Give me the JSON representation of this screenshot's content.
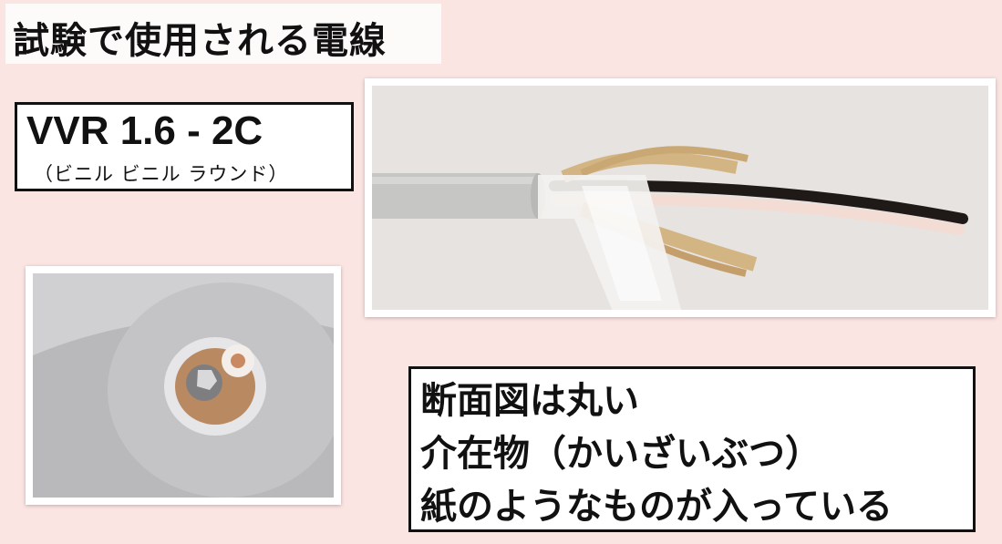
{
  "title": "試験で使用される電線",
  "spec": {
    "name": "VVR 1.6 - 2C",
    "reading": "（ビニル ビニル ラウンド）"
  },
  "notes": [
    "断面図は丸い",
    "介在物（かいざいぶつ）",
    "紙のようなものが入っている"
  ],
  "colors": {
    "background": "#fbe5e3",
    "box_border": "#111111",
    "cable_sheath": "#c8c8c6",
    "black_wire": "#1f1a18",
    "white_wire": "#f2dcd3",
    "paper_filler": "#d3b483"
  }
}
